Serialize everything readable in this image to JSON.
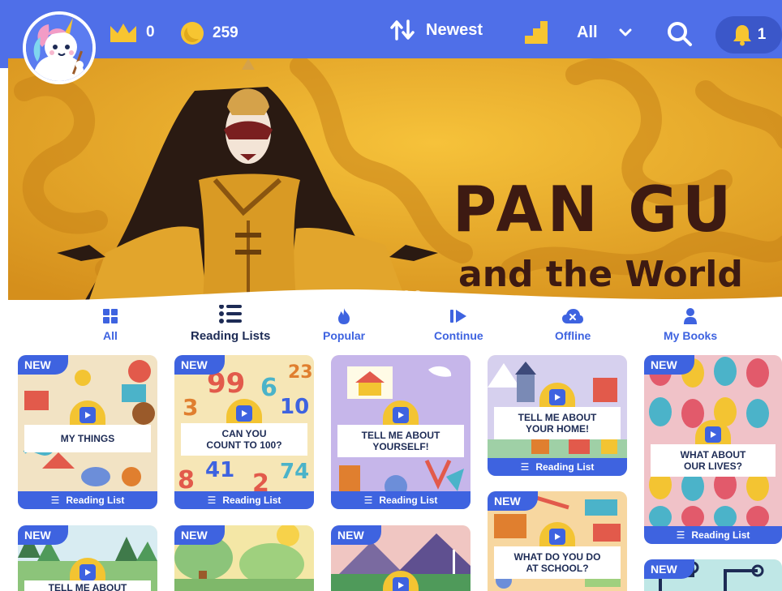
{
  "topbar": {
    "crowns": "0",
    "coins": "259",
    "sort_label": "Newest",
    "filter_label": "All",
    "notifications": "1"
  },
  "hero": {
    "title": "PAN GU",
    "subtitle": "and the World",
    "slides": 5,
    "active_slide": 2
  },
  "tabs": [
    {
      "label": "All",
      "icon": "grid-icon"
    },
    {
      "label": "Reading Lists",
      "icon": "list-icon"
    },
    {
      "label": "Popular",
      "icon": "flame-icon"
    },
    {
      "label": "Continue",
      "icon": "resume-icon"
    },
    {
      "label": "Offline",
      "icon": "cloud-icon"
    },
    {
      "label": "My Books",
      "icon": "person-icon"
    }
  ],
  "cards": {
    "badge": "NEW",
    "footer": "Reading List",
    "c1": "MY THINGS",
    "c2a": "CAN YOU",
    "c2b": "COUNT TO 100?",
    "c3a": "TELL ME ABOUT",
    "c3b": "YOURSELF!",
    "c4a": "TELL ME ABOUT",
    "c4b": "YOUR HOME!",
    "c5a": "WHAT ABOUT",
    "c5b": "OUR LIVES?",
    "c6a": "TELL ME ABOUT",
    "c8a": "WHAT DO YOU DO",
    "c8b": "AT SCHOOL?"
  },
  "colors": {
    "primary": "#4f6fe8",
    "accent": "#3e63e0",
    "gold": "#f3c432",
    "dark": "#1d2b55"
  }
}
